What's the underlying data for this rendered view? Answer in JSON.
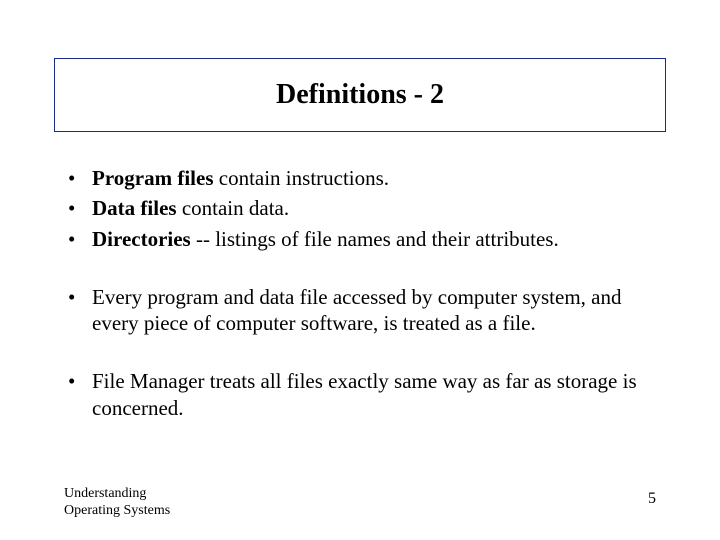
{
  "title": "Definitions - 2",
  "bullets": [
    {
      "bold": "Program files",
      "rest": " contain instructions."
    },
    {
      "bold": "Data files",
      "rest": " contain data."
    },
    {
      "bold": "Directories",
      "rest": " --  listings of file names and their attributes."
    }
  ],
  "para1": "Every program and data file accessed by computer system, and every piece of computer software, is treated as a file.",
  "para2": "File Manager treats all files exactly same way as far as storage is concerned.",
  "footer": {
    "line1": "Understanding",
    "line2": "Operating Systems",
    "page": "5"
  }
}
